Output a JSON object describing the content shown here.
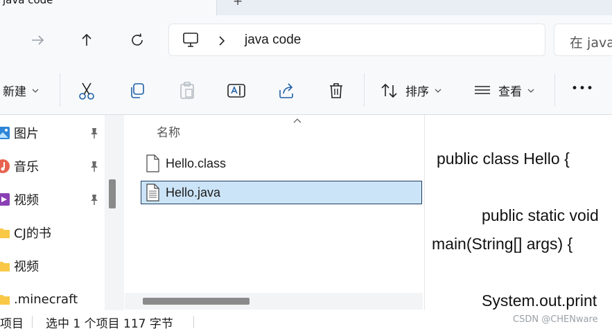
{
  "tab": {
    "title": "java code",
    "new_tab": "+"
  },
  "address": {
    "path": "java code",
    "search_placeholder": "在 java"
  },
  "commands": {
    "new": "新建",
    "sort": "排序",
    "view": "查看",
    "more": "•••"
  },
  "sidebar": {
    "items": [
      {
        "label": "图片",
        "pinned": true,
        "icon": "pictures-icon"
      },
      {
        "label": "音乐",
        "pinned": true,
        "icon": "music-icon"
      },
      {
        "label": "视频",
        "pinned": true,
        "icon": "videos-icon"
      },
      {
        "label": "CJ的书",
        "pinned": false,
        "icon": "folder-icon"
      },
      {
        "label": "视频",
        "pinned": false,
        "icon": "folder-icon"
      },
      {
        "label": ".minecraft",
        "pinned": false,
        "icon": "folder-icon"
      }
    ]
  },
  "filelist": {
    "column_name": "名称",
    "files": [
      {
        "name": "Hello.class",
        "selected": false
      },
      {
        "name": "Hello.java",
        "selected": true
      }
    ]
  },
  "preview": {
    "lines": [
      "public class Hello {",
      "public static void",
      "main(String[] args) {",
      "System.out.print"
    ]
  },
  "status": {
    "count": "项目",
    "selection": "选中 1 个项目  117 字节"
  },
  "watermark": "CSDN @CHENware",
  "colors": {
    "accent": "#0067c0",
    "selection": "#cce4f7",
    "folder": "#f8c846"
  }
}
